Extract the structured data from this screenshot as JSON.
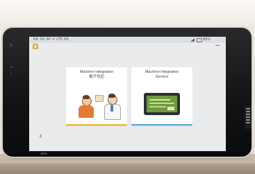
{
  "status_bar": {
    "left_text": "RR 3G AP ✦ LTE 99",
    "battery_text": "99%"
  },
  "cards": [
    {
      "title": "Machine Integration\n電子化記",
      "accent": "#e8b840"
    },
    {
      "title": "Machine Integration\nService",
      "accent": "#58a8d8"
    }
  ],
  "icons": {
    "app_logo": "app-logo-icon",
    "menu": "menu-icon",
    "back": "back-arrow-icon",
    "signal": "signal-icon",
    "battery": "battery-icon"
  },
  "colors": {
    "screen_bg": "#e9ebed",
    "card_bg": "#ffffff",
    "tablet_bezel": "#141416"
  }
}
